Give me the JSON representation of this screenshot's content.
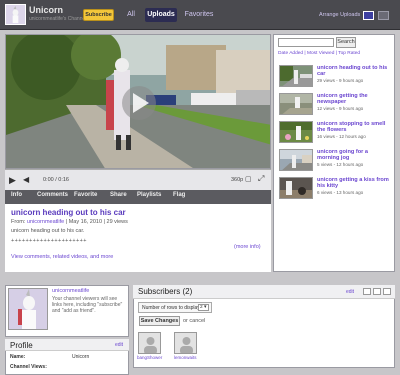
{
  "channel": {
    "name": "Unicorn",
    "subtitle": "unicornmeatlife's Channel",
    "subscribe_label": "Subscribe"
  },
  "tabs": [
    {
      "label": "All",
      "selected": false
    },
    {
      "label": "Uploads",
      "selected": true
    },
    {
      "label": "Favorites",
      "selected": false
    }
  ],
  "arrange_label": "Arrange Uploads",
  "player": {
    "time": "0:00 / 0:16",
    "quality": "360p"
  },
  "player_tabs": [
    "Info",
    "Comments",
    "Favorite",
    "Share",
    "Playlists",
    "Flag"
  ],
  "video_info": {
    "title": "unicorn heading out to his car",
    "from_label": "From:",
    "from_user": "unicornmeatlife",
    "date_views": "| May 16, 2010 | 29 views",
    "description": "unicorn heading out to his car.",
    "stars": "+++++++++++++++++++++",
    "more_info": "(more info)",
    "view_comments": "View comments, related videos, and more"
  },
  "sidebar": {
    "search_label": "Search",
    "sort_links": "Date Added | Most Viewed | Top Rated",
    "videos": [
      {
        "title": "unicorn heading out to his car",
        "meta": "29 views - 9 hours ago"
      },
      {
        "title": "unicorn getting the newspaper",
        "meta": "12 views - 9 hours ago"
      },
      {
        "title": "unicorn stopping to smell the flowers",
        "meta": "16 views - 12 hours ago"
      },
      {
        "title": "unicorn going for a morning jog",
        "meta": "5 views - 12 hours ago"
      },
      {
        "title": "unicorn getting a kiss from his kitty",
        "meta": "6 views - 13 hours ago"
      }
    ]
  },
  "profile_card": {
    "name": "unicornmeatlife",
    "text": "Your channel viewers will see links here, including \"subscribe\" and \"add as friend\"."
  },
  "subscribers": {
    "title": "Subscribers (2)",
    "edit": "edit",
    "rows_label": "Number of rows to display",
    "rows_value": "2",
    "save_label": "Save Changes",
    "or_cancel": "or cancel",
    "users": [
      "bangShower",
      "lemonwaits"
    ]
  },
  "profile": {
    "title": "Profile",
    "edit": "edit",
    "rows": [
      {
        "label": "Name:",
        "value": "Unicorn"
      },
      {
        "label": "Channel Views:",
        "value": ""
      }
    ]
  },
  "colors": {
    "accent": "#6b47d1",
    "header_bg": "#4a4a4f",
    "subscribe": "#f3c63a"
  }
}
